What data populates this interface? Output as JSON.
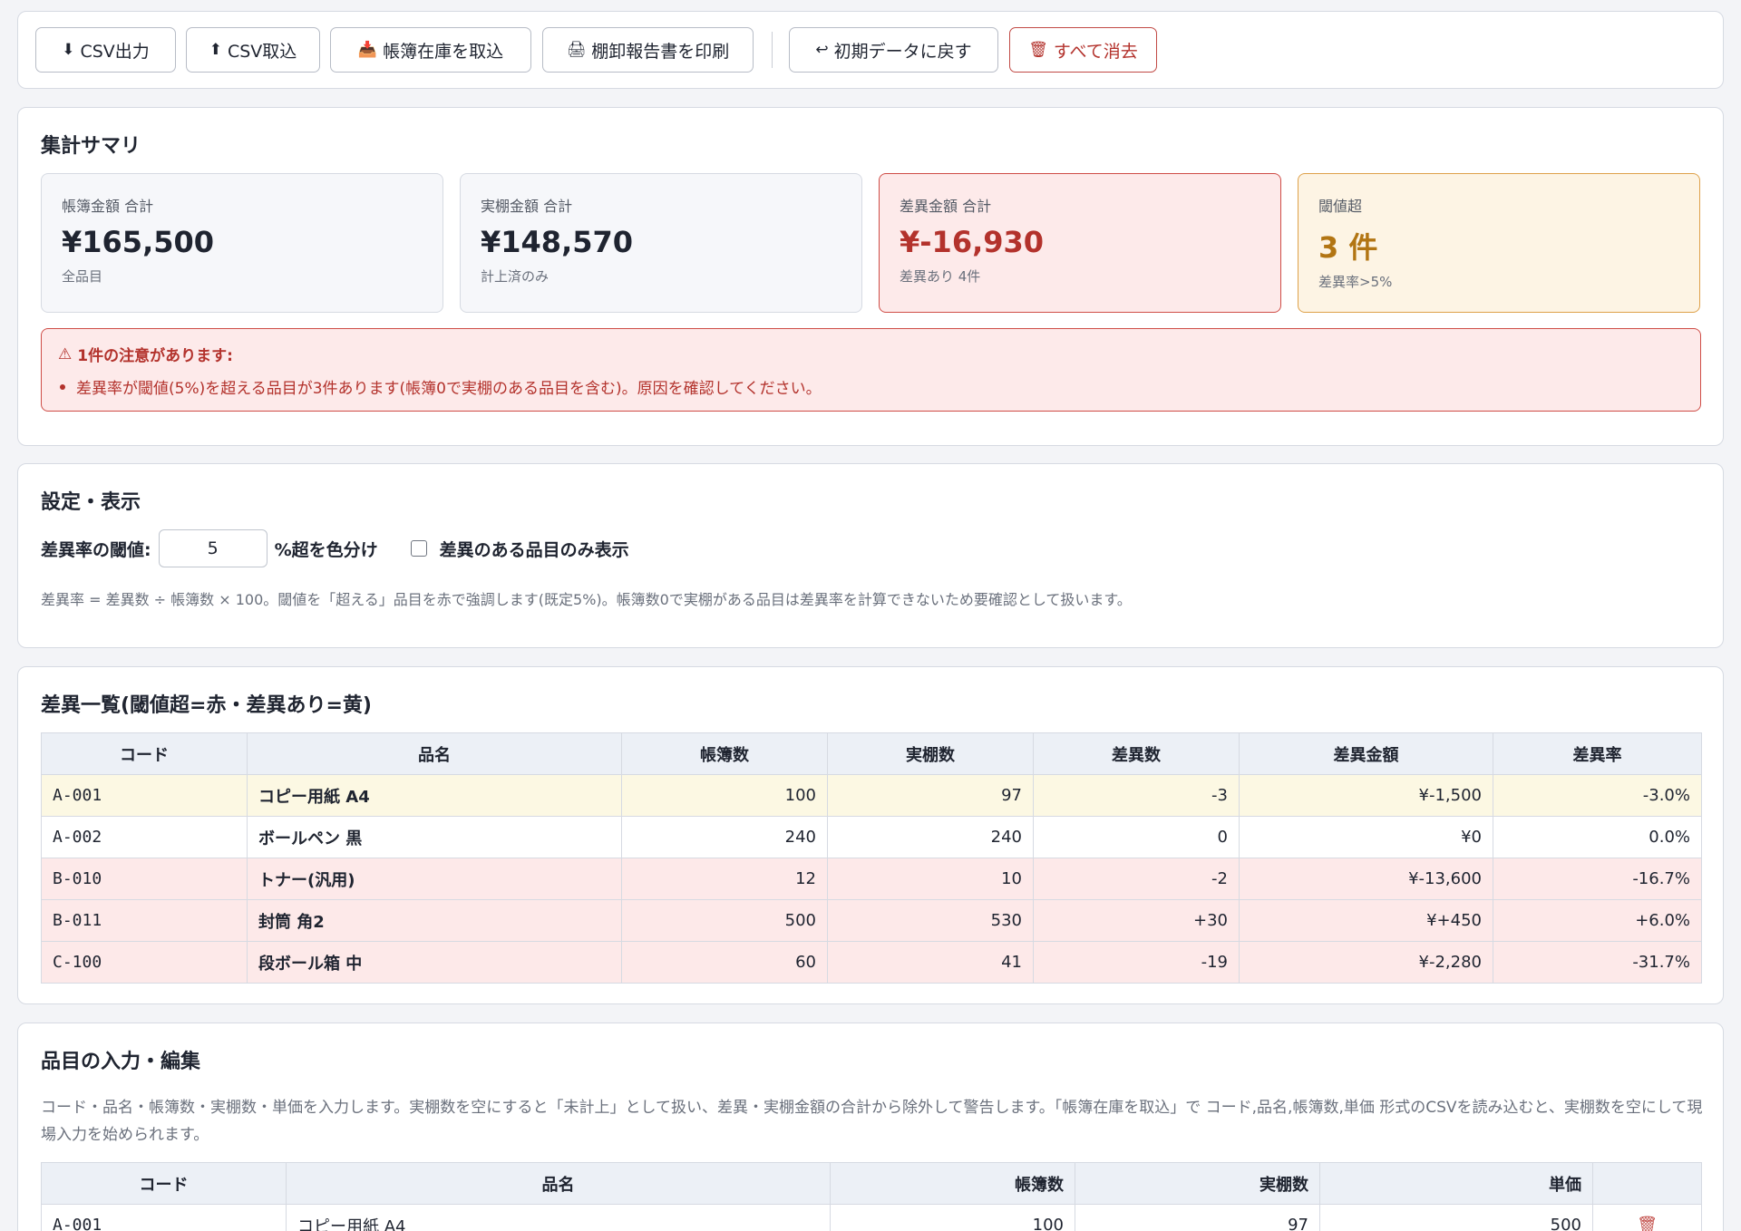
{
  "toolbar": {
    "csv_export": "CSV出力",
    "csv_import": "CSV取込",
    "ledger_import": "帳簿在庫を取込",
    "print_report": "棚卸報告書を印刷",
    "reset": "初期データに戻す",
    "clear_all": "すべて消去",
    "icons": {
      "csv_export": "⬇",
      "csv_import": "⬆",
      "ledger_import": "📥",
      "print_report": "🖨",
      "reset": "↩",
      "clear_all": "🗑"
    }
  },
  "summary": {
    "title": "集計サマリ",
    "cards": [
      {
        "label": "帳簿金額 合計",
        "value": "¥165,500",
        "sub": "全品目"
      },
      {
        "label": "実棚金額 合計",
        "value": "¥148,570",
        "sub": "計上済のみ"
      },
      {
        "label": "差異金額 合計",
        "value": "¥-16,930",
        "sub": "差異あり 4件"
      },
      {
        "label": "閾値超",
        "value": "3 件",
        "sub": "差異率>5%"
      }
    ],
    "alert": {
      "icon": "⚠",
      "heading": "1件の注意があります:",
      "items": [
        "差異率が閾値(5%)を超える品目が3件あります(帳簿0で実棚のある品目を含む)。原因を確認してください。"
      ]
    }
  },
  "settings": {
    "title": "設定・表示",
    "threshold_label": "差異率の閾値:",
    "threshold_value": "5",
    "threshold_suffix": "%超を色分け",
    "only_diff_label": "差異のある品目のみ表示",
    "note": "差異率 = 差異数 ÷ 帳簿数 × 100。閾値を「超える」品目を赤で強調します(既定5%)。帳簿数0で実棚がある品目は差異率を計算できないため要確認として扱います。"
  },
  "diff_table": {
    "title": "差異一覧(閾値超=赤・差異あり=黄)",
    "headers": [
      "コード",
      "品名",
      "帳簿数",
      "実棚数",
      "差異数",
      "差異金額",
      "差異率"
    ],
    "rows": [
      {
        "code": "A-001",
        "name": "コピー用紙 A4",
        "book": "100",
        "actual": "97",
        "diff": "-3",
        "amount": "¥-1,500",
        "rate": "-3.0%",
        "status": "yellow"
      },
      {
        "code": "A-002",
        "name": "ボールペン 黒",
        "book": "240",
        "actual": "240",
        "diff": "0",
        "amount": "¥0",
        "rate": "0.0%",
        "status": "plain"
      },
      {
        "code": "B-010",
        "name": "トナー(汎用)",
        "book": "12",
        "actual": "10",
        "diff": "-2",
        "amount": "¥-13,600",
        "rate": "-16.7%",
        "status": "red"
      },
      {
        "code": "B-011",
        "name": "封筒 角2",
        "book": "500",
        "actual": "530",
        "diff": "+30",
        "amount": "¥+450",
        "rate": "+6.0%",
        "status": "red"
      },
      {
        "code": "C-100",
        "name": "段ボール箱 中",
        "book": "60",
        "actual": "41",
        "diff": "-19",
        "amount": "¥-2,280",
        "rate": "-31.7%",
        "status": "red"
      }
    ]
  },
  "edit": {
    "title": "品目の入力・編集",
    "note": "コード・品名・帳簿数・実棚数・単価を入力します。実棚数を空にすると「未計上」として扱い、差異・実棚金額の合計から除外して警告します。「帳簿在庫を取込」で コード,品名,帳簿数,単価 形式のCSVを読み込むと、実棚数を空にして現場入力を始められます。",
    "headers": [
      "コード",
      "品名",
      "帳簿数",
      "実棚数",
      "単価",
      ""
    ],
    "rows": [
      {
        "code": "A-001",
        "name": "コピー用紙 A4",
        "book": "100",
        "actual": "97",
        "price": "500",
        "delete_icon": "🗑"
      }
    ]
  },
  "colors": {
    "danger": "#b3322c",
    "warning": "#b27513",
    "row_red": "#fde9e9",
    "row_yellow": "#fcf8e3"
  }
}
